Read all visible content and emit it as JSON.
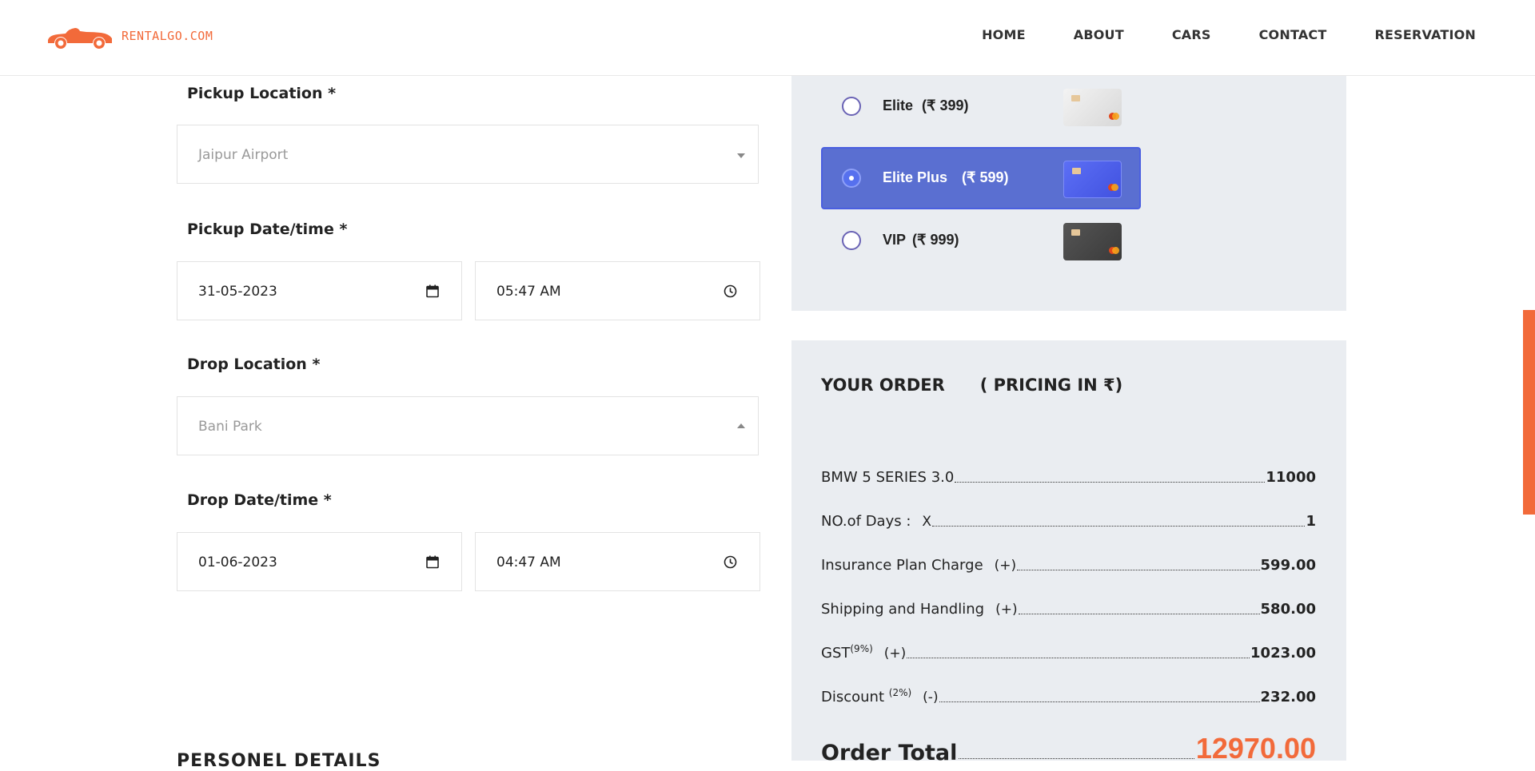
{
  "brand": {
    "logo_text": "RENTALGO.COM",
    "accent_color": "#f26a3a"
  },
  "nav": {
    "items": [
      {
        "label": "HOME"
      },
      {
        "label": "ABOUT"
      },
      {
        "label": "CARS"
      },
      {
        "label": "CONTACT"
      },
      {
        "label": "RESERVATION"
      }
    ]
  },
  "form": {
    "pickup_location": {
      "label": "Pickup Location *",
      "value": "Jaipur Airport"
    },
    "pickup_datetime": {
      "label": "Pickup Date/time *",
      "date": "31-05-2023",
      "time": "05:47 AM"
    },
    "drop_location": {
      "label": "Drop Location *",
      "value": "Bani Park"
    },
    "drop_datetime": {
      "label": "Drop Date/time *",
      "date": "01-06-2023",
      "time": "04:47 AM"
    },
    "next_section_title": "PERSONEL DETAILS"
  },
  "insurance": {
    "plans": [
      {
        "name": "Elite",
        "price": "(₹ 399)",
        "selected": false,
        "card_icon": "silver-card-icon"
      },
      {
        "name": "Elite Plus",
        "price": "(₹ 599)",
        "selected": true,
        "card_icon": "blue-card-icon"
      },
      {
        "name": "VIP",
        "price": "(₹ 999)",
        "selected": false,
        "card_icon": "black-card-icon"
      }
    ]
  },
  "order": {
    "title": "YOUR ORDER",
    "pricing_note": "( PRICING IN ₹)",
    "rows": [
      {
        "label": "BMW 5 SERIES 3.0",
        "op": "",
        "sup": "",
        "amount": "11000"
      },
      {
        "label": "NO.of Days :",
        "op": "X",
        "sup": "",
        "amount": "1"
      },
      {
        "label": "Insurance Plan Charge",
        "op": "(+)",
        "sup": "",
        "amount": "599.00"
      },
      {
        "label": "Shipping and Handling",
        "op": "(+)",
        "sup": "",
        "amount": "580.00"
      },
      {
        "label": "GST",
        "op": "(+)",
        "sup": "(9%)",
        "amount": "1023.00"
      },
      {
        "label": "Discount",
        "op": "(-)",
        "sup": "(2%)",
        "amount": "232.00"
      }
    ],
    "total_label": "Order Total",
    "total_amount": "12970.00"
  }
}
